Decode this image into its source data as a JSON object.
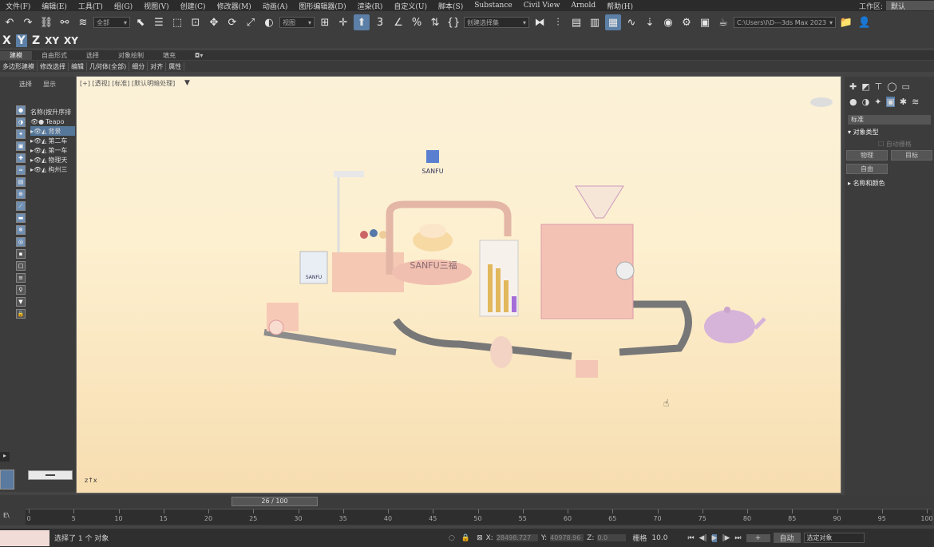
{
  "menu": [
    "文件(F)",
    "编辑(E)",
    "工具(T)",
    "组(G)",
    "视图(V)",
    "创建(C)",
    "修改器(M)",
    "动画(A)",
    "图形编辑器(D)",
    "渲染(R)",
    "自定义(U)",
    "脚本(S)",
    "Substance",
    "Civil View",
    "Arnold",
    "帮助(H)"
  ],
  "workspace": {
    "label": "工作区:",
    "value": "默认"
  },
  "toolbar": {
    "filter_dropdown": "全部",
    "view_dropdown": "视图",
    "selection_set": "创建选择集",
    "path": "C:\\Users\\l\\D---3ds Max 2023"
  },
  "axes": [
    "X",
    "Y",
    "Z",
    "XY",
    "XY"
  ],
  "ribbon_tabs": [
    "建模",
    "自由形式",
    "选择",
    "对象绘制",
    "填充"
  ],
  "ribbon_sub": [
    "多边形建模",
    "修改选择",
    "编辑",
    "几何体(全部)",
    "细分",
    "对齐",
    "属性"
  ],
  "scene_tabs": [
    "选择",
    "显示"
  ],
  "scene_header": "名称(按升序排",
  "scene_rows": [
    "Teapo",
    "背景",
    "第二车",
    "第一车",
    "物理天",
    "构州三"
  ],
  "viewport_label": "[+] [透视] [标准] [默认明暗处理]",
  "viewport_logo": "SANFU",
  "right_panel": {
    "input": "标准",
    "section1": "对象类型",
    "autogrid": "自动栅格",
    "btn_physics": "物理",
    "btn_target": "目标",
    "btn_free": "自由",
    "section2": "名称和颜色"
  },
  "timeline": {
    "slider": "26 / 100",
    "ticks": [
      "0",
      "5",
      "10",
      "15",
      "20",
      "25",
      "30",
      "35",
      "40",
      "45",
      "50",
      "55",
      "60",
      "65",
      "70",
      "75",
      "80",
      "85",
      "90",
      "95",
      "100"
    ]
  },
  "status": {
    "text": "选择了 1 个 对象",
    "x_label": "X:",
    "x_value": "28498.727",
    "y_label": "Y:",
    "y_value": "40978.96",
    "z_label": "Z:",
    "z_value": "0.0",
    "grid_label": "栅格",
    "grid_value": "10.0",
    "auto": "自动",
    "selected": "选定对象"
  },
  "colors": {
    "accent": "#5b7fa6",
    "viewport_bg": "#fdf0d0"
  }
}
